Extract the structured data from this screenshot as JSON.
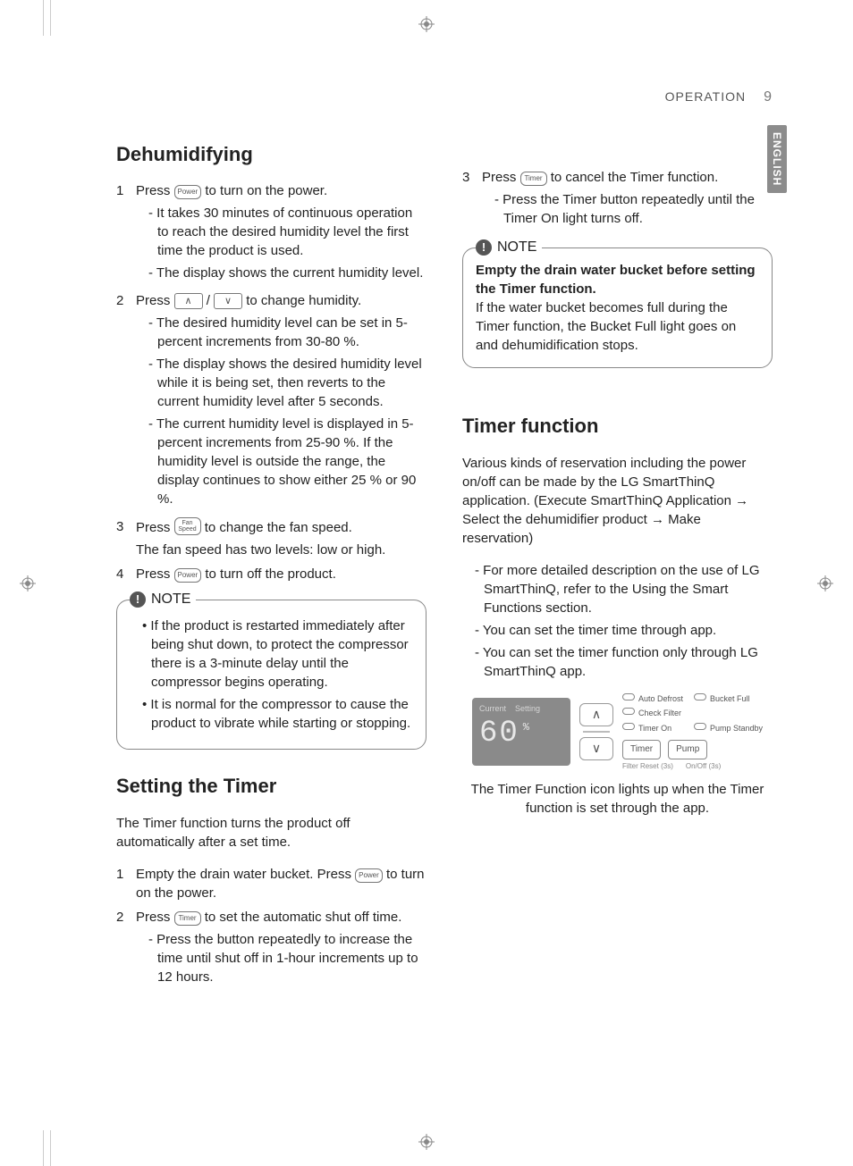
{
  "header": {
    "section": "OPERATION",
    "page": "9",
    "language_tab": "ENGLISH"
  },
  "labels": {
    "note": "NOTE"
  },
  "buttons": {
    "power": "Power",
    "up": "∧",
    "down": "∨",
    "fan_speed": "Fan\nSpeed",
    "timer": "Timer"
  },
  "dehumidifying": {
    "heading": "Dehumidifying",
    "step1": {
      "text_a": "Press ",
      "text_b": " to turn on the power.",
      "subs": [
        "It takes 30 minutes of continuous operation to reach the desired humidity level the first time the product is used.",
        "The display shows the current humidity level."
      ]
    },
    "step2": {
      "text_a": "Press ",
      "text_mid": " / ",
      "text_b": " to change humidity.",
      "subs": [
        "The desired humidity level can be set in 5-percent increments from 30-80 %.",
        "The display shows the desired humidity level while it is being set, then reverts to the current humidity level after 5 seconds.",
        "The current humidity level is displayed in 5-percent increments from 25-90 %. If the humidity level is outside the range, the display continues to show either 25 % or 90 %."
      ]
    },
    "step3": {
      "text_a": "Press ",
      "text_b": " to change the fan speed.",
      "tail": "The fan speed has two levels: low or high."
    },
    "step4": {
      "text_a": "Press ",
      "text_b": " to turn off the product."
    },
    "note_items": [
      "If the product is restarted immediately after being shut down, to protect the compressor there is a 3-minute delay until the compressor begins operating.",
      "It is normal for the compressor to cause the product to vibrate while starting or stopping."
    ]
  },
  "setting_timer": {
    "heading": "Setting the Timer",
    "intro": "The Timer function turns the product off automatically after a set time.",
    "step1": {
      "text_a": "Empty the drain water bucket. Press ",
      "text_b": " to turn on the power."
    },
    "step2": {
      "text_a": "Press ",
      "text_b": " to set the automatic shut off time.",
      "subs": [
        "Press the button repeatedly to increase the time until shut off in 1-hour increments up to 12 hours."
      ]
    },
    "step3": {
      "text_a": "Press ",
      "text_b": " to cancel the Timer function.",
      "subs": [
        "Press the Timer button repeatedly until the Timer On light turns off."
      ]
    },
    "note_bold": "Empty the drain water bucket before setting the Timer function.",
    "note_body": "If the water bucket becomes full during the Timer function, the Bucket Full light goes on and dehumidification stops."
  },
  "timer_function": {
    "heading": "Timer function",
    "intro": "Various kinds of reservation including the power on/off can be made by the LG SmartThinQ application. (Execute SmartThinQ Application → Select the dehumidifier product → Make reservation)",
    "bullets": [
      "For more detailed description on the use of LG SmartThinQ, refer to the Using the Smart Functions section.",
      "You can set the timer time through app.",
      "You can set the timer function only through LG SmartThinQ app."
    ],
    "caption": "The Timer Function icon lights up when the Timer function is set through the app."
  },
  "diagram": {
    "lcd_mode_current": "Current",
    "lcd_mode_setting": "Setting",
    "lcd_value": "60",
    "lcd_unit": "%",
    "indicators": [
      "Auto Defrost",
      "Bucket Full",
      "Check Filter",
      "Timer On",
      "Pump Standby"
    ],
    "dev_timer": "Timer",
    "dev_pump": "Pump",
    "tiny_filter": "Filter Reset (3s)",
    "tiny_onoff": "On/Off (3s)"
  }
}
